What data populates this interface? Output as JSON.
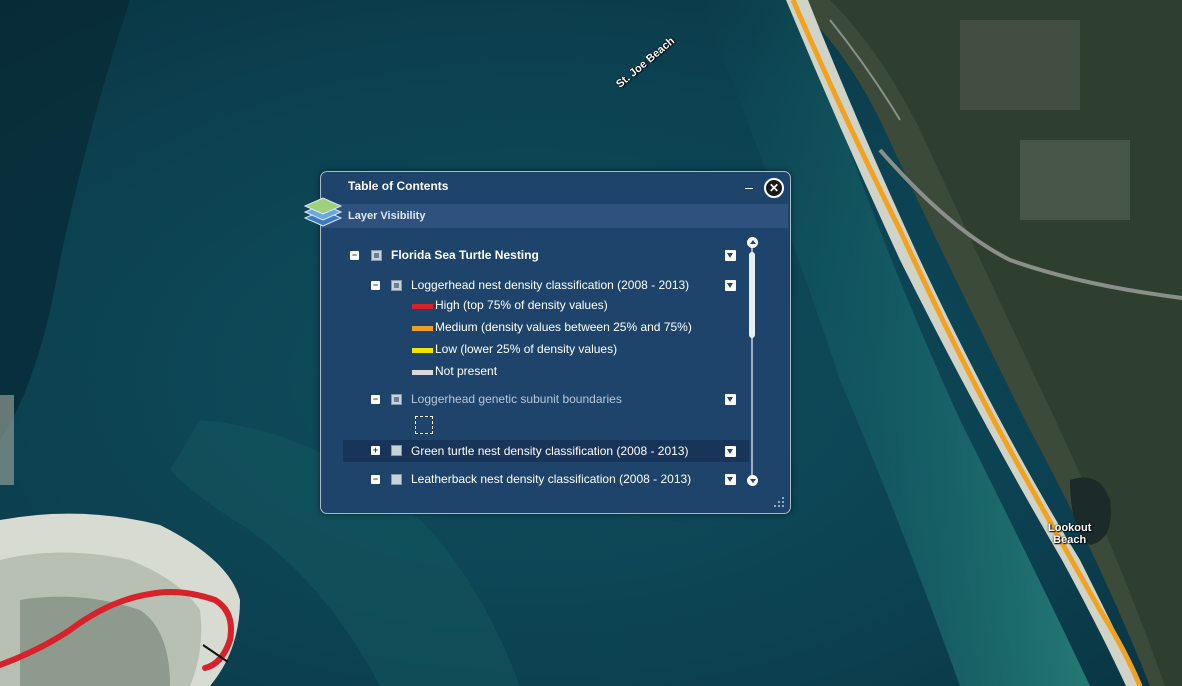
{
  "map": {
    "labels": {
      "st_joe": "St. Joe Beach",
      "lookout_line1": "Lookout",
      "lookout_line2": "Beach"
    }
  },
  "toc": {
    "title": "Table of Contents",
    "minimize_glyph": "–",
    "close_glyph": "✕",
    "section_title": "Layer Visibility",
    "group": {
      "label": "Florida Sea Turtle Nesting",
      "checked": true
    },
    "layers": [
      {
        "label": "Loggerhead nest density classification (2008 - 2013)",
        "checked": true,
        "legend": [
          {
            "label": "High (top 75% of density values)",
            "color": "#d8222b"
          },
          {
            "label": "Medium (density values between 25% and 75%)",
            "color": "#f0a020"
          },
          {
            "label": "Low (lower 25% of density values)",
            "color": "#f2e600"
          },
          {
            "label": "Not present",
            "color": "#d8d8d8"
          }
        ]
      },
      {
        "label": "Loggerhead genetic subunit boundaries",
        "checked": true
      },
      {
        "label": "Green turtle nest density classification (2008 - 2013)",
        "checked": false
      },
      {
        "label": "Leatherback nest density classification (2008 - 2013)",
        "checked": false
      }
    ]
  },
  "icons": {
    "layers": "layers-icon",
    "close": "close-icon",
    "minimize": "minimize-icon",
    "expand": "expand-icon",
    "menu": "menu-arrow-icon"
  },
  "colors": {
    "panel_bg": "#20446e",
    "high": "#d8222b",
    "medium": "#f0a020",
    "low": "#f2e600",
    "not_present": "#d8d8d8"
  }
}
